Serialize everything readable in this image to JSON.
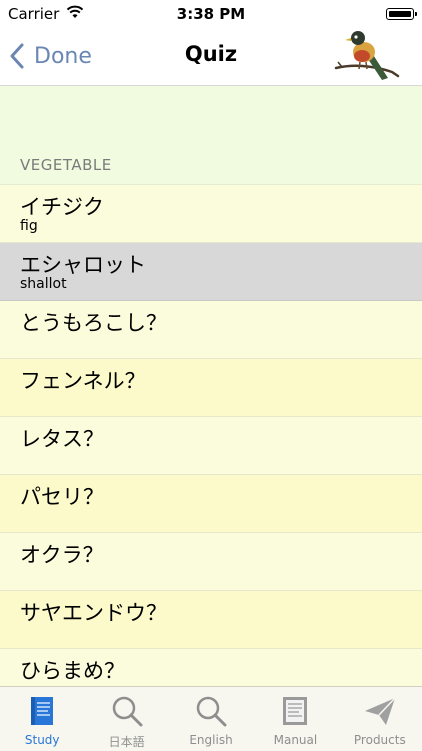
{
  "status_bar": {
    "carrier": "Carrier",
    "time": "3:38 PM"
  },
  "nav": {
    "back_label": "Done",
    "title": "Quiz"
  },
  "section": {
    "label": "VEGETABLE"
  },
  "rows": [
    {
      "ja": "イチジク",
      "en": "fig"
    },
    {
      "ja": "エシャロット",
      "en": "shallot",
      "selected": true
    },
    {
      "ja": "とうもろこし？",
      "en": ""
    },
    {
      "ja": "フェンネル？",
      "en": ""
    },
    {
      "ja": "レタス？",
      "en": ""
    },
    {
      "ja": "パセリ？",
      "en": ""
    },
    {
      "ja": "オクラ？",
      "en": ""
    },
    {
      "ja": "サヤエンドウ？",
      "en": ""
    },
    {
      "ja": "ひらまめ？",
      "en": ""
    }
  ],
  "tabs": [
    {
      "label": "Study",
      "icon": "study-book-icon",
      "active": true
    },
    {
      "label": "日本語",
      "icon": "search-icon"
    },
    {
      "label": "English",
      "icon": "search-icon"
    },
    {
      "label": "Manual",
      "icon": "manual-book-icon"
    },
    {
      "label": "Products",
      "icon": "paper-plane-icon"
    }
  ],
  "colors": {
    "accent": "#2876d8",
    "back": "#6a87b4",
    "row_light": "#fbfcdc",
    "row_yellow": "#fcfacb",
    "header": "#f1fbe0"
  }
}
